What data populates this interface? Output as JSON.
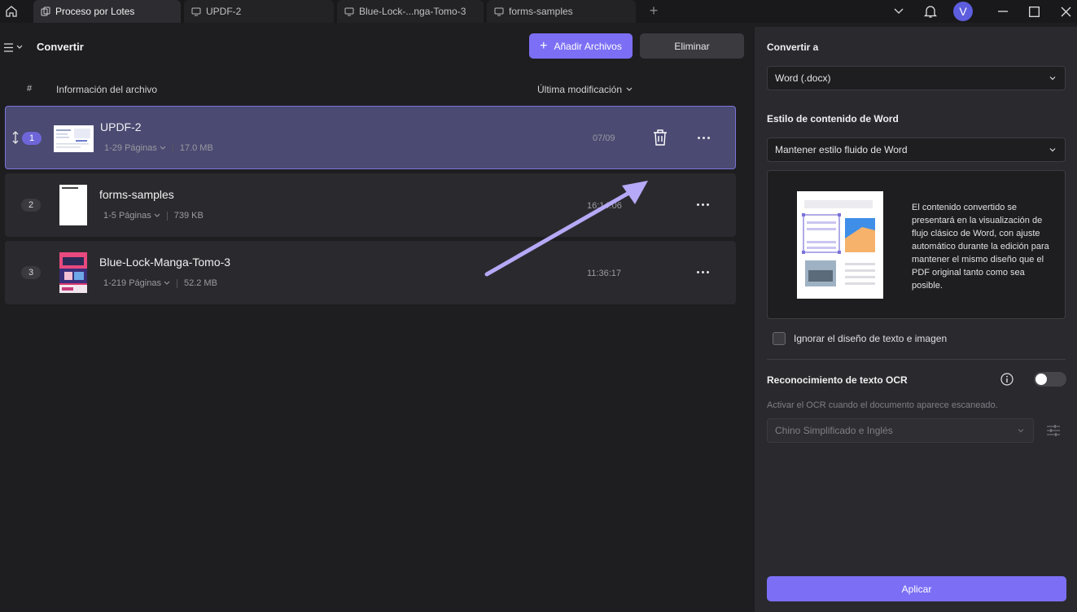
{
  "tabs": [
    {
      "label": "Proceso por Lotes",
      "icon": "batch-icon",
      "active": true
    },
    {
      "label": "UPDF-2",
      "icon": "document-icon",
      "active": false
    },
    {
      "label": "Blue-Lock-...nga-Tomo-3",
      "icon": "document-icon",
      "active": false
    },
    {
      "label": "forms-samples",
      "icon": "document-icon",
      "active": false
    }
  ],
  "user": {
    "avatar_letter": "V"
  },
  "header": {
    "title": "Convertir",
    "add_label": "Añadir Archivos",
    "delete_label": "Eliminar"
  },
  "table": {
    "col_number": "#",
    "col_info": "Información del archivo",
    "col_modified": "Última modificación",
    "rows": [
      {
        "number": "1",
        "name": "UPDF-2",
        "pages": "1-29 Páginas",
        "size": "17.0 MB",
        "modified": "07/09",
        "selected": true
      },
      {
        "number": "2",
        "name": "forms-samples",
        "pages": "1-5 Páginas",
        "size": "739 KB",
        "modified": "16:14:06",
        "selected": false
      },
      {
        "number": "3",
        "name": "Blue-Lock-Manga-Tomo-3",
        "pages": "1-219 Páginas",
        "size": "52.2 MB",
        "modified": "11:36:17",
        "selected": false
      }
    ]
  },
  "panel": {
    "convert_to_label": "Convertir a",
    "convert_to_value": "Word (.docx)",
    "style_label": "Estilo de contenido de Word",
    "style_value": "Mantener estilo fluido de Word",
    "style_description": "El contenido convertido se presentará en la visualización de flujo clásico de Word, con ajuste automático durante la edición para mantener el mismo diseño que el PDF original tanto como sea posible.",
    "ignore_layout_label": "Ignorar el diseño de texto e imagen",
    "ignore_layout_checked": false,
    "ocr_label": "Reconocimiento de texto OCR",
    "ocr_enabled": false,
    "ocr_hint": "Activar el OCR cuando el documento aparece escaneado.",
    "ocr_language": "Chino Simplificado e Inglés",
    "apply_label": "Aplicar"
  },
  "colors": {
    "accent": "#7c6ff5",
    "selected_row": "#4a4a72",
    "arrow": "#b6a9f7"
  }
}
